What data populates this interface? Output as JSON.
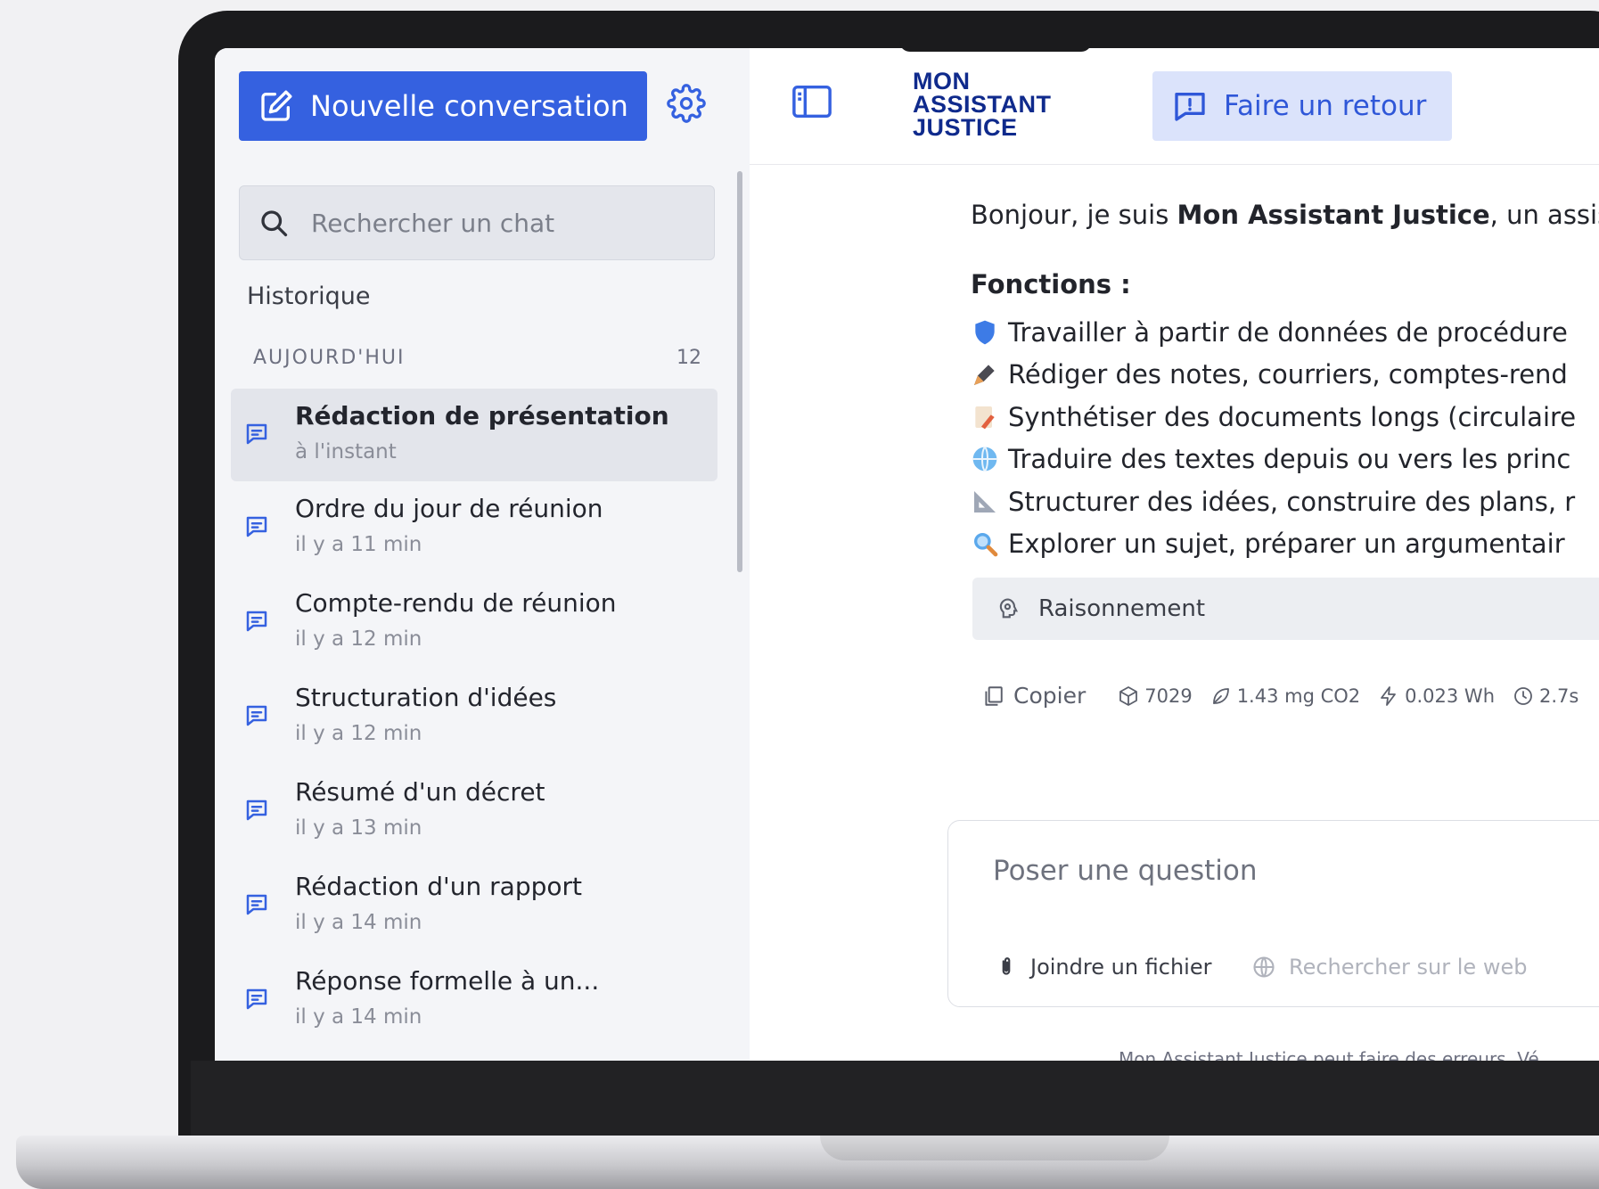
{
  "sidebar": {
    "new_conversation_label": "Nouvelle conversation",
    "search_placeholder": "Rechercher un chat",
    "history_title": "Historique",
    "section_label": "AUJOURD'HUI",
    "section_count": "12",
    "chats": [
      {
        "title": "Rédaction de présentation",
        "time": "à l'instant"
      },
      {
        "title": "Ordre du jour de réunion",
        "time": "il y a 11 min"
      },
      {
        "title": "Compte-rendu de réunion",
        "time": "il y a 12 min"
      },
      {
        "title": "Structuration d'idées",
        "time": "il y a 12 min"
      },
      {
        "title": "Résumé d'un décret",
        "time": "il y a 13 min"
      },
      {
        "title": "Rédaction d'un rapport",
        "time": "il y a 14 min"
      },
      {
        "title": "Réponse formelle à un...",
        "time": "il y a 14 min"
      }
    ]
  },
  "header": {
    "logo_line1": "MON",
    "logo_line2": "ASSISTANT",
    "logo_line3": "JUSTICE",
    "feedback_label": "Faire un retour"
  },
  "message": {
    "greeting_prefix": "Bonjour, je suis ",
    "greeting_name": "Mon Assistant Justice",
    "greeting_suffix": ", un assist",
    "functions_title": "Fonctions :",
    "functions": [
      {
        "icon": "shield-icon",
        "text": "Travailler à partir de données de procédure"
      },
      {
        "icon": "pen-icon",
        "text": "Rédiger des notes, courriers, comptes-rend"
      },
      {
        "icon": "memo-icon",
        "text": "Synthétiser des documents longs (circulaire"
      },
      {
        "icon": "globe-icon",
        "text": "Traduire des textes depuis ou vers les princ"
      },
      {
        "icon": "triangle-ruler-icon",
        "text": "Structurer des idées, construire des plans, r"
      },
      {
        "icon": "magnifier-icon",
        "text": "Explorer un sujet, préparer un argumentair"
      }
    ],
    "reasoning_label": "Raisonnement",
    "copy_label": "Copier",
    "tokens": "7029",
    "co2": "1.43 mg CO2",
    "energy": "0.023 Wh",
    "duration": "2.7s"
  },
  "composer": {
    "placeholder": "Poser une question",
    "attach_label": "Joindre un fichier",
    "web_search_label": "Rechercher sur le web"
  },
  "footer": {
    "disclaimer": "Mon Assistant Justice peut faire des erreurs. Vé"
  },
  "colors": {
    "accent": "#3561e0",
    "brand_navy": "#0f2a8c",
    "feedback_bg": "#dbe3fb"
  }
}
